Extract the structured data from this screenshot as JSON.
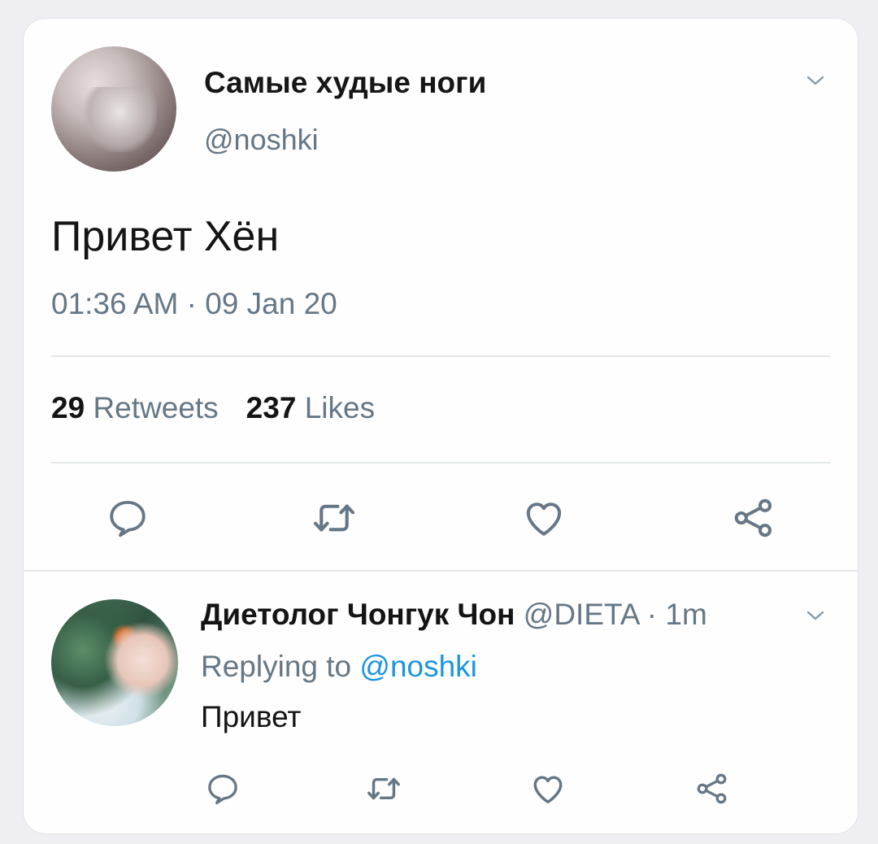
{
  "tweet": {
    "author_name": "Самые худые ноги",
    "author_handle": "@noshki",
    "text": "Привет Хён",
    "timestamp": "01:36 AM · 09 Jan 20",
    "retweets_count": "29",
    "retweets_label": "Retweets",
    "likes_count": "237",
    "likes_label": "Likes"
  },
  "reply": {
    "author_name": "Диетолог Чонгук Чон",
    "meta": "@DIETA · 1m",
    "replying_prefix": "Replying to",
    "replying_handle": "@noshki",
    "text": "Привет"
  },
  "icons": {
    "reply": "reply-icon",
    "retweet": "retweet-icon",
    "like": "heart-icon",
    "share": "share-icon",
    "more": "chevron-down-icon"
  },
  "colors": {
    "secondary_text": "#657786",
    "link": "#1b95e0",
    "icon": "#657786"
  }
}
